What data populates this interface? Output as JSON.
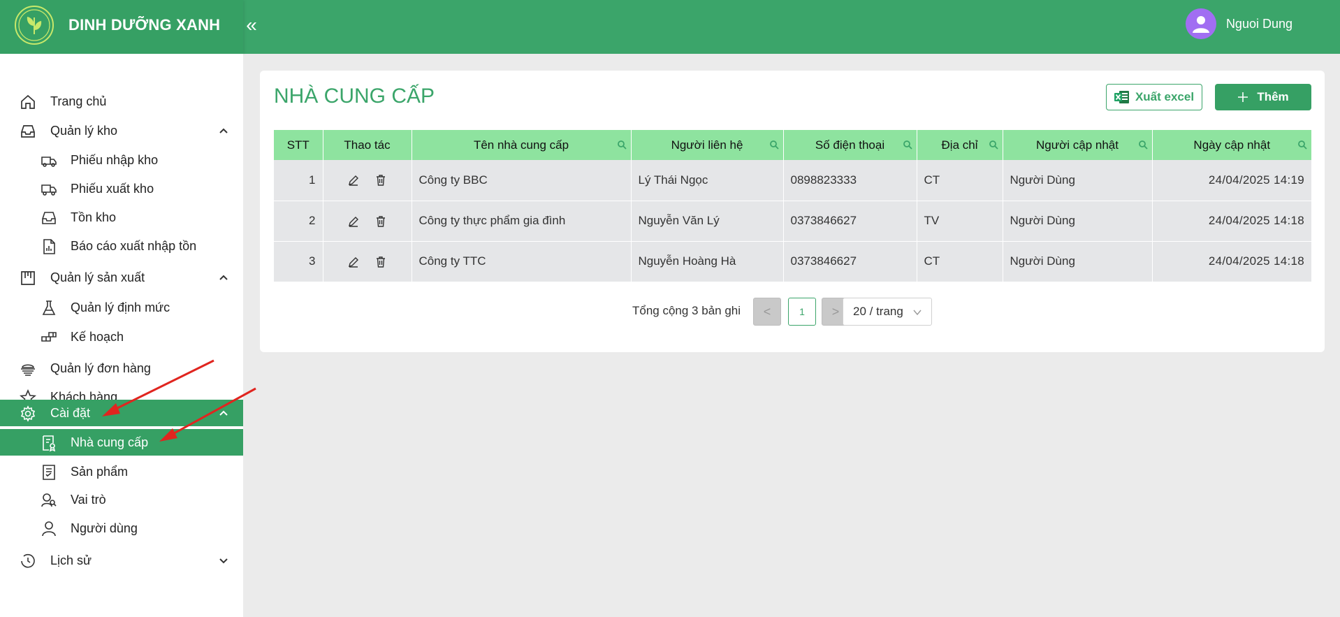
{
  "header": {
    "brand_name": "DINH DƯỠNG XANH",
    "collapse_icon": "double-chevron-left-icon",
    "collapse_label": "«",
    "user_name": "Nguoi Dung",
    "accent": "#3ba56a"
  },
  "sidebar": {
    "items": [
      {
        "label": "Trang chủ",
        "icon": "home-icon"
      },
      {
        "label": "Quản lý kho",
        "icon": "inbox-icon"
      },
      {
        "label": "Phiếu nhập kho",
        "icon": "truck-in-icon"
      },
      {
        "label": "Phiếu xuất kho",
        "icon": "truck-out-icon"
      },
      {
        "label": "Tồn kho",
        "icon": "inbox-icon"
      },
      {
        "label": "Báo cáo xuất nhập tồn",
        "icon": "report-icon"
      },
      {
        "label": "Quản lý sản xuất",
        "icon": "factory-icon"
      },
      {
        "label": "Quản lý định mức",
        "icon": "flask-icon"
      },
      {
        "label": "Kế hoạch",
        "icon": "blocks-icon"
      },
      {
        "label": "Quản lý đơn hàng",
        "icon": "order-icon"
      },
      {
        "label": "Khách hàng",
        "icon": "star-icon"
      },
      {
        "label": "Cài đặt",
        "icon": "gear-icon"
      },
      {
        "label": "Nhà cung cấp",
        "icon": "supplier-icon"
      },
      {
        "label": "Sản phẩm",
        "icon": "product-icon"
      },
      {
        "label": "Vai trò",
        "icon": "roles-icon"
      },
      {
        "label": "Người dùng",
        "icon": "user-icon"
      },
      {
        "label": "Lịch sử",
        "icon": "clock-icon"
      }
    ]
  },
  "main": {
    "title": "NHÀ CUNG CẤP",
    "export_label": "Xuất excel",
    "add_label": "Thêm",
    "columns": [
      "STT",
      "Thao tác",
      "Tên nhà cung cấp",
      "Người liên hệ",
      "Số điện thoại",
      "Địa chỉ",
      "Người cập nhật",
      "Ngày cập nhật"
    ],
    "rows": [
      {
        "stt": "1",
        "name": "Công ty BBC",
        "contact": "Lý Thái Ngọc",
        "phone": "0898823333",
        "address": "CT",
        "updated_by": "Người Dùng",
        "updated_at": "24/04/2025 14:19"
      },
      {
        "stt": "2",
        "name": "Công ty thực phẩm gia đình",
        "contact": "Nguyễn Văn Lý",
        "phone": "0373846627",
        "address": "TV",
        "updated_by": "Người Dùng",
        "updated_at": "24/04/2025 14:18"
      },
      {
        "stt": "3",
        "name": "Công ty TTC",
        "contact": "Nguyễn Hoàng Hà",
        "phone": "0373846627",
        "address": "CT",
        "updated_by": "Người Dùng",
        "updated_at": "24/04/2025 14:18"
      }
    ],
    "pagination": {
      "total_text": "Tổng cộng 3 bản ghi",
      "prev": "<",
      "current_page": "1",
      "next": ">",
      "page_size": "20 / trang"
    }
  }
}
